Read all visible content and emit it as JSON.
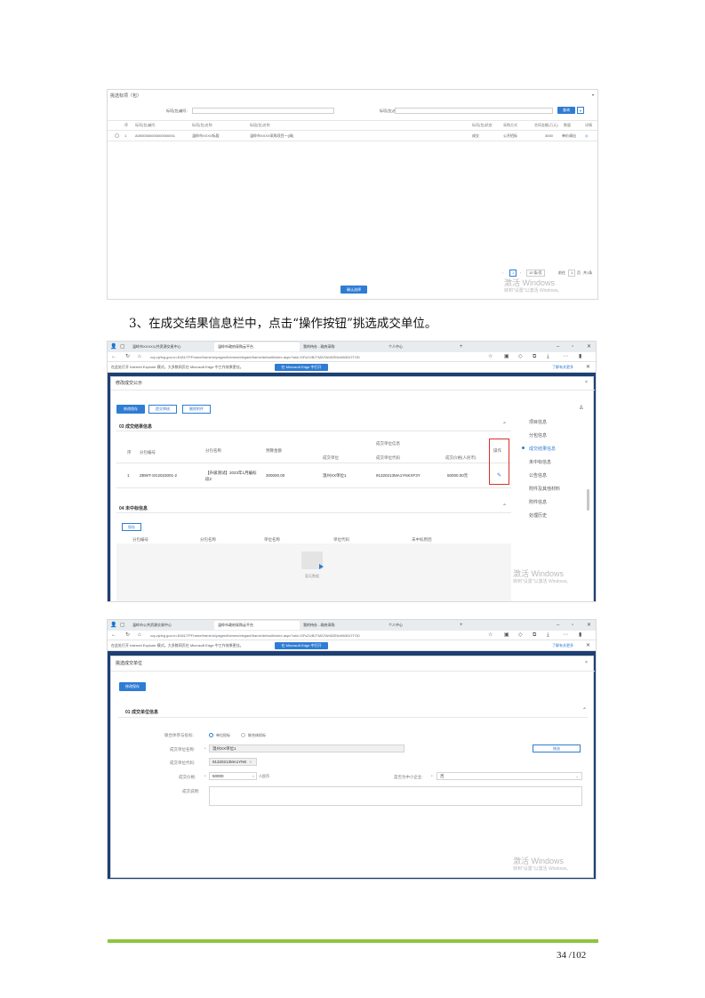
{
  "shot1": {
    "title": "挑选标项（包）",
    "filter_code_label": "标项(包)编号:",
    "filter_name_label": "标项(包)名称:",
    "query_button": "查询",
    "columns": [
      "序",
      "标项(包)编号",
      "标项(包)名称",
      "标段(包)名称",
      "标项(包)状态",
      "采购方式",
      "合同金额(万元)",
      "数量",
      "详情"
    ],
    "row": {
      "index": "1",
      "code": "A0000000000000000001",
      "package_name": "温岭市XXXX标段",
      "section_name": "温岭市XXXX采购项目一(调)",
      "status": "成交",
      "method": "公开招标",
      "amount": "3000",
      "qty": "单价调出"
    },
    "pagination": {
      "page": "1",
      "per_page": "10 条/页",
      "goto_label": "前往",
      "goto_value": "1",
      "page_suffix": "页",
      "total": "共1条"
    },
    "confirm_button": "确认选择",
    "watermark_title": "激活 Windows",
    "watermark_sub": "转到\"设置\"以激活 Windows。"
  },
  "caption": "3、在成交结果信息栏中，点击“操作按钮”挑选成交单位。",
  "browser": {
    "tabs": [
      "温岭市XXXX公共资源交易中心",
      "温岭市政府采购云平台",
      "我的待办 - 政府采购",
      "个人中心"
    ],
    "url": "zcy.zjzfcg.gov.cn:8181/TPFrame/frame/ui/pages/themes/elegant/frame/default/index.aspx?wid=GFsZUBJTM2ZWd0ZEtoWk5DOTOD",
    "info_text": "在此处打开 Internet Explorer 模式。大多数网页在 Microsoft Edge 中工作效果更佳。",
    "edge_button": "在 Microsoft Edge 中打开",
    "info_link": "了解有关更多"
  },
  "shot2": {
    "dialog_title": "修改成交公示",
    "buttons": [
      "修改保存",
      "提交审核",
      "删除附件"
    ],
    "section1": "03 成交结果信息",
    "table_headers": {
      "index": "序",
      "code": "分包编号",
      "name": "分包名称",
      "budget": "预算金额",
      "group": "成交单位信息",
      "unit": "成交单位",
      "credit": "成交单位代码",
      "price": "成交价格(人民币)",
      "op": "操作"
    },
    "row": {
      "index": "1",
      "code": "ZBWT-SG2023001-2",
      "name": "【升级测试】2023年1月编标段2",
      "budget": "300000.00",
      "unit": "温州XX单位1",
      "credit": "91320213MA1YNKXF3Y",
      "price": "50000.00元"
    },
    "section2": "04 未中标信息",
    "add_button": "保存",
    "empty_headers": [
      "分包编号",
      "分包名称",
      "单位名称",
      "单位代码",
      "未中标原因"
    ],
    "empty_text": "暂无数据",
    "side_items": [
      "项目信息",
      "分包信息",
      "成交结果信息",
      "未中标信息",
      "公告信息",
      "附件及其他材料",
      "附件信息",
      "处理历史"
    ],
    "watermark_title": "激活 Windows",
    "watermark_sub": "转到\"设置\"以激活 Windows。"
  },
  "shot3": {
    "tabs": [
      "温岭市公共资源交易中心",
      "温岭市政府采购云平台",
      "我的待办 - 政府采购",
      "个人中心"
    ],
    "dialog_title": "挑选成交单位",
    "save_button": "修改保存",
    "section": "01 成交单位信息",
    "radio_label": "联合体参与投标:",
    "radio_options": [
      "单位投标",
      "联合体投标"
    ],
    "unit_label": "成交单位名称:",
    "unit_value": "温州XX单位1",
    "select_button": "挑选",
    "code_label": "成交单位代码:",
    "code_value": "91320213MA1YNK",
    "price_label": "成交价格:",
    "price_value": "50000",
    "price_unit": "人民币",
    "small_label": "是否为中小企业:",
    "small_value": "否",
    "remark_label": "成交说明:",
    "watermark_title": "激活 Windows",
    "watermark_sub": "转到\"设置\"以激活 Windows。"
  },
  "page_number": "34 /102",
  "colors": {
    "accent": "#2f7cd4",
    "footer_green": "#8dc63f",
    "highlight_red": "#d9312b"
  }
}
